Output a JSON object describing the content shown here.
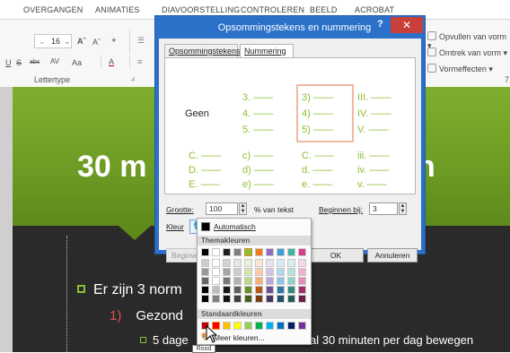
{
  "ribbon": {
    "tabs": [
      "OVERGANGEN",
      "ANIMATIES",
      "DIAVOORSTELLING",
      "CONTROLEREN",
      "BEELD",
      "ACROBAT"
    ],
    "font_size": "16",
    "group_label": "Lettertype",
    "grow_font": "Aˆ",
    "shrink_font": "Aˇ",
    "underline": "U",
    "strike": "S",
    "abc": "abc",
    "av": "AV",
    "aa": "Aa",
    "font_color": "A",
    "side_buttons": [
      "Opvullen van vorm",
      "Omtrek van vorm",
      "Vormeffecten"
    ],
    "side_group_tail": "7"
  },
  "slide": {
    "title": "30 m",
    "title_end": "n",
    "bullet1": "Er zijn 3 norm",
    "num1_marker": "1)",
    "num1_text": "Gezond",
    "sub1_a": "5 dage",
    "sub1_b": "al 30 minuten per dag bewegen"
  },
  "dialog": {
    "title": "Opsommingstekens en nummering",
    "help": "?",
    "close": "✕",
    "tabs": [
      "Opsommingstekens",
      "Nummering"
    ],
    "active_tab": "Nummering",
    "none_label": "Geen",
    "grid": [
      [
        "3.  ——",
        "3)  ——",
        "III.  ——"
      ],
      [
        "4.  ——",
        "4)  ——",
        "IV.  ——"
      ],
      [
        "5.  ——",
        "5)  ——",
        "V.  ——"
      ]
    ],
    "grid2": [
      [
        "C.  ——",
        "c)  ——",
        "C.  ——",
        "iii.  ——"
      ],
      [
        "D.  ——",
        "d)  ——",
        "d.  ——",
        "iv.  ——"
      ],
      [
        "E.  ——",
        "e)  ——",
        "e.  ——",
        "v.  ——"
      ]
    ],
    "size_label": "Grootte:",
    "size_value": "100",
    "size_unit": "% van tekst",
    "start_label": "Beginnen bij:",
    "start_value": "3",
    "color_label": "Kleur",
    "ok": "OK",
    "cancel": "Annuleren",
    "begin_partial": "Beginw"
  },
  "picker": {
    "automatic": "Automatisch",
    "theme_header": "Themakleuren",
    "standard_header": "Standaardkleuren",
    "more_colors": "Meer kleuren...",
    "tooltip": "Rood",
    "theme_colors": [
      "#000000",
      "#ffffff",
      "#1f1f1f",
      "#808080",
      "#8cbf32",
      "#f07b1c",
      "#8e6cbf",
      "#3e9dd8",
      "#3fb6a8",
      "#d63d8c"
    ],
    "standard_colors": [
      "#c00000",
      "#ff0000",
      "#ffc000",
      "#ffff00",
      "#92d050",
      "#00b050",
      "#00b0f0",
      "#0070c0",
      "#002060",
      "#7030a0"
    ]
  }
}
